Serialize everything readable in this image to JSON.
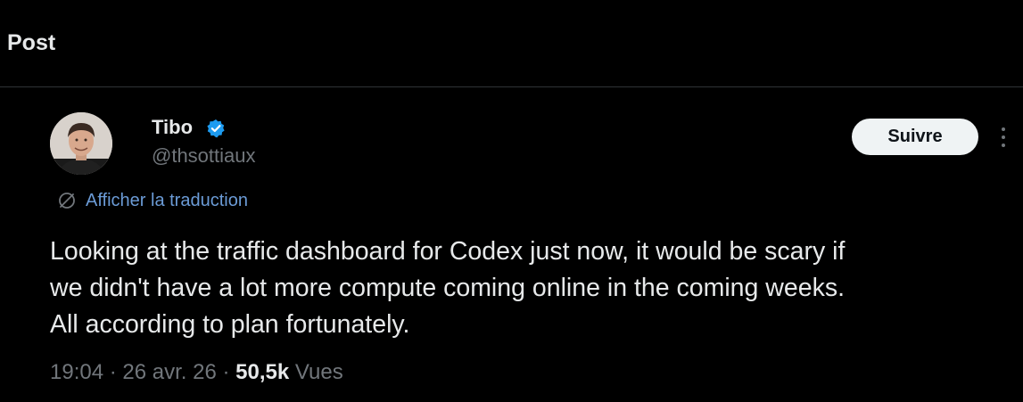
{
  "header": {
    "title": "Post"
  },
  "author": {
    "name": "Tibo",
    "handle": "@thsottiaux",
    "verified": true,
    "avatar_icon": "profile-photo"
  },
  "follow_button": {
    "label": "Suivre"
  },
  "translation": {
    "label": "Afficher la traduction",
    "icon": "translate-icon"
  },
  "tweet": {
    "lines": [
      "Looking at the traffic dashboard for Codex just now, it would be scary if",
      "we didn't have a lot more compute coming online in the coming weeks.",
      "All according to plan fortunately."
    ]
  },
  "meta": {
    "time": "19:04",
    "separator": " · ",
    "date": "26 avr. 26",
    "views_count": "50,5k",
    "views_label": "Vues"
  },
  "colors": {
    "background": "#000000",
    "text": "#e7e9ea",
    "secondary": "#71767b",
    "link": "#6b9bd6",
    "verified": "#1d9bf0"
  }
}
